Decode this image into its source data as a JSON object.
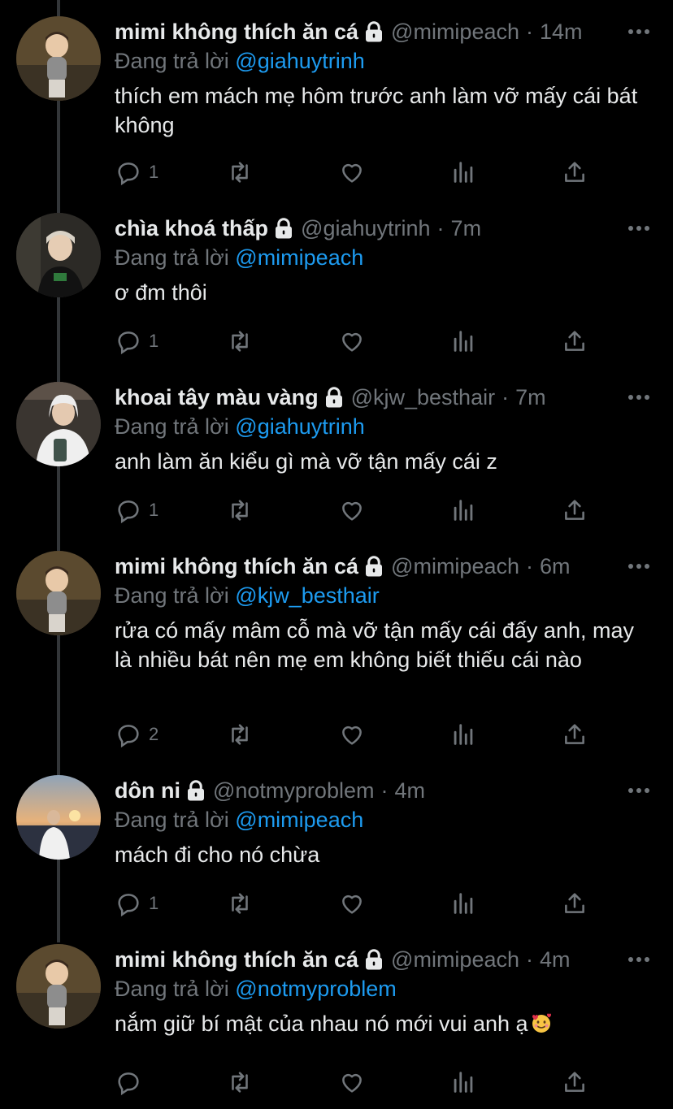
{
  "tweets": [
    {
      "display_name": "mimi không thích ăn cá",
      "handle": "@mimipeach",
      "separator": "·",
      "time": "14m",
      "replying_prefix": "Đang trả lời",
      "replying_to": "@giahuytrinh",
      "text": "thích em mách mẹ hôm trước anh làm vỡ mấy cái bát không",
      "reply_count": "1",
      "avatar": "mimi-avatar"
    },
    {
      "display_name": "chìa khoá thấp",
      "handle": "@giahuytrinh",
      "separator": "·",
      "time": "7m",
      "replying_prefix": "Đang trả lời",
      "replying_to": "@mimipeach",
      "text": "ơ đm thôi",
      "reply_count": "1",
      "avatar": "giahuy-avatar"
    },
    {
      "display_name": "khoai tây màu vàng",
      "handle": "@kjw_besthair",
      "separator": "·",
      "time": "7m",
      "replying_prefix": "Đang trả lời",
      "replying_to": "@giahuytrinh",
      "text": "anh làm ăn kiểu gì mà vỡ tận mấy cái z",
      "reply_count": "1",
      "avatar": "kjw-avatar"
    },
    {
      "display_name": "mimi không thích ăn cá",
      "handle": "@mimipeach",
      "separator": "·",
      "time": "6m",
      "replying_prefix": "Đang trả lời",
      "replying_to": "@kjw_besthair",
      "text": "rửa có mấy mâm cỗ mà vỡ tận mấy cái đấy anh, may là nhiều bát nên mẹ em không biết thiếu cái nào",
      "reply_count": "2",
      "avatar": "mimi-avatar"
    },
    {
      "display_name": "dôn ni",
      "handle": "@notmyproblem",
      "separator": "·",
      "time": "4m",
      "replying_prefix": "Đang trả lời",
      "replying_to": "@mimipeach",
      "text": "mách đi cho nó chừa",
      "reply_count": "1",
      "avatar": "donni-avatar"
    },
    {
      "display_name": "mimi không thích ăn cá",
      "handle": "@mimipeach",
      "separator": "·",
      "time": "4m",
      "replying_prefix": "Đang trả lời",
      "replying_to": "@notmyproblem",
      "text": "nắm giữ bí mật của nhau nó mới vui anh ạ",
      "emoji": "smiling-face-with-hearts",
      "reply_count": "",
      "avatar": "mimi-avatar"
    }
  ],
  "colors": {
    "background": "#000000",
    "primary_text": "#e7e9ea",
    "secondary_text": "#71767b",
    "mention": "#1d9bf0",
    "thread_line": "#333639"
  },
  "icons": [
    "lock-icon",
    "more-icon",
    "reply-icon",
    "retweet-icon",
    "like-icon",
    "views-icon",
    "share-icon"
  ]
}
